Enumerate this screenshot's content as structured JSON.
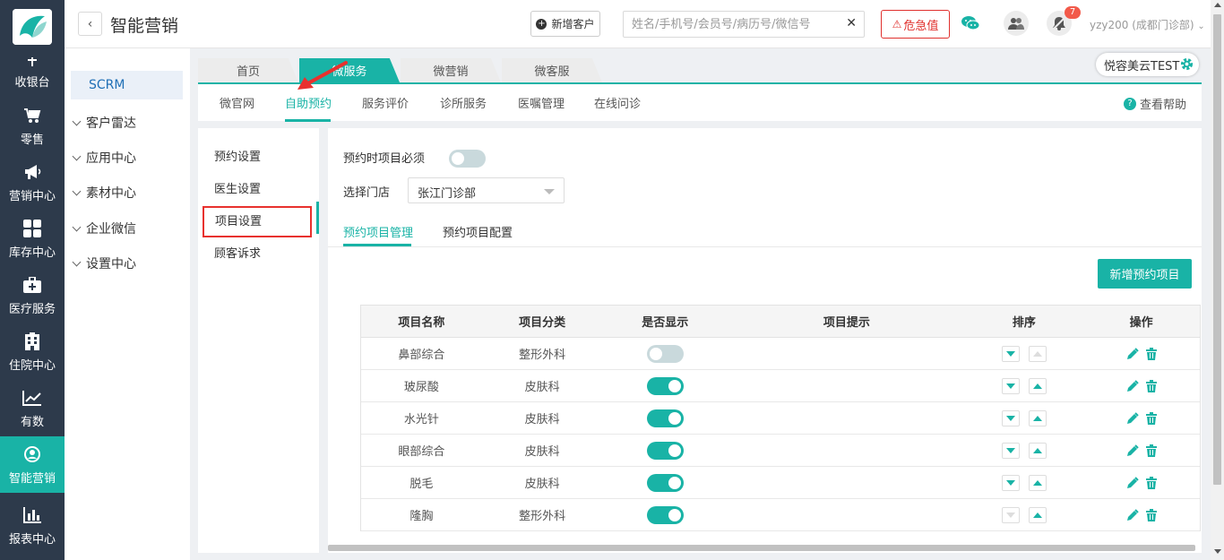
{
  "nav": {
    "items": [
      {
        "label": "收银台",
        "icon": "cash-register-icon"
      },
      {
        "label": "零售",
        "icon": "cart-icon"
      },
      {
        "label": "营销中心",
        "icon": "megaphone-icon"
      },
      {
        "label": "库存中心",
        "icon": "grid-icon"
      },
      {
        "label": "医疗服务",
        "icon": "medical-kit-icon"
      },
      {
        "label": "住院中心",
        "icon": "building-icon"
      },
      {
        "label": "有数",
        "icon": "trend-icon"
      },
      {
        "label": "智能营销",
        "icon": "smart-marketing-icon",
        "active": true
      },
      {
        "label": "报表中心",
        "icon": "bar-chart-icon"
      }
    ]
  },
  "header": {
    "title": "智能营销",
    "add_customer": "新增客户",
    "search_placeholder": "姓名/手机号/会员号/病历号/微信号",
    "danger_label": "危急值",
    "notification_count": "7",
    "user": "yzy200 (成都门诊部)"
  },
  "sidemenu": {
    "scrm": "SCRM",
    "items": [
      "客户雷达",
      "应用中心",
      "素材中心",
      "企业微信",
      "设置中心"
    ]
  },
  "tabs": [
    "首页",
    "微服务",
    "微营销",
    "微客服"
  ],
  "brand": "悦容美云TEST",
  "subnav": {
    "items": [
      "微官网",
      "自助预约",
      "服务评价",
      "诊所服务",
      "医嘱管理",
      "在线问诊"
    ],
    "help": "查看帮助"
  },
  "settings_menu": [
    "预约设置",
    "医生设置",
    "项目设置",
    "顾客诉求"
  ],
  "form": {
    "required_label": "预约时项目必须",
    "required_on": false,
    "store_label": "选择门店",
    "store_value": "张江门诊部"
  },
  "inner_tabs": [
    "预约项目管理",
    "预约项目配置"
  ],
  "add_button": "新增预约项目",
  "table": {
    "headers": [
      "项目名称",
      "项目分类",
      "是否显示",
      "项目提示",
      "排序",
      "操作"
    ],
    "rows": [
      {
        "name": "鼻部综合",
        "category": "整形外科",
        "shown": false,
        "up_disabled": true,
        "down_disabled": false
      },
      {
        "name": "玻尿酸",
        "category": "皮肤科",
        "shown": true,
        "up_disabled": false,
        "down_disabled": false
      },
      {
        "name": "水光针",
        "category": "皮肤科",
        "shown": true,
        "up_disabled": false,
        "down_disabled": false
      },
      {
        "name": "眼部综合",
        "category": "皮肤科",
        "shown": true,
        "up_disabled": false,
        "down_disabled": false
      },
      {
        "name": "脱毛",
        "category": "皮肤科",
        "shown": true,
        "up_disabled": false,
        "down_disabled": false
      },
      {
        "name": "隆胸",
        "category": "整形外科",
        "shown": true,
        "up_disabled": false,
        "down_disabled": true
      }
    ]
  },
  "colors": {
    "accent": "#19b3a6",
    "nav_bg": "#2d3a4b",
    "danger": "#e0312e"
  }
}
